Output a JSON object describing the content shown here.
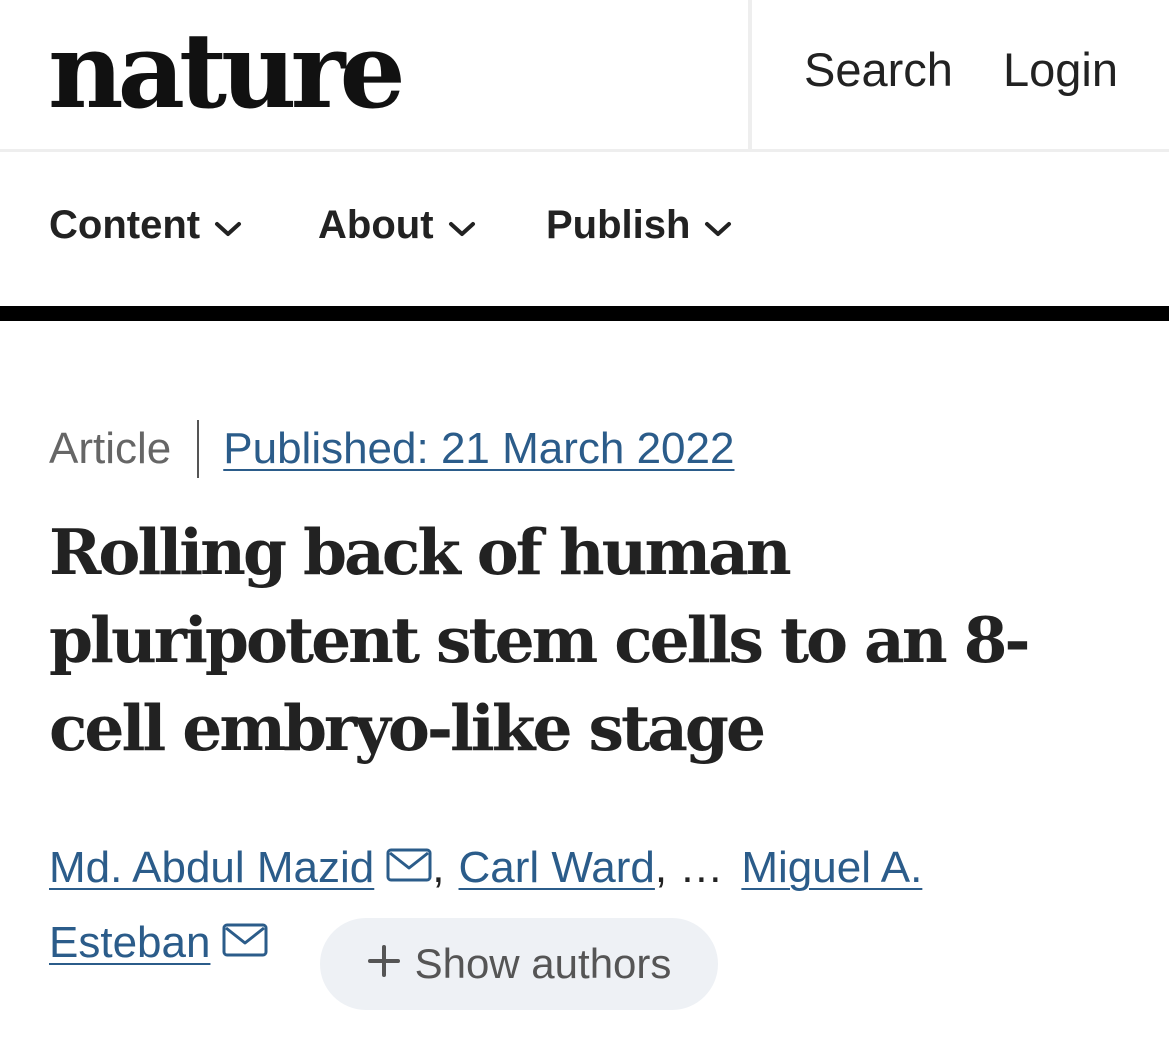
{
  "header": {
    "logo": "nature",
    "search_label": "Search",
    "login_label": "Login"
  },
  "nav": {
    "items": [
      {
        "label": "Content"
      },
      {
        "label": "About"
      },
      {
        "label": "Publish"
      }
    ]
  },
  "article": {
    "type": "Article",
    "published": "Published: 21 March 2022",
    "title": "Rolling back of human pluripotent stem cells to an 8-cell embryo-like stage",
    "authors": {
      "first": "Md. Abdul Mazid",
      "sep1": ",",
      "second": "Carl Ward",
      "ellipsis": ", …",
      "last_part1": "Miguel A.",
      "last_part2": "Esteban",
      "show_authors": "Show authors"
    }
  },
  "colors": {
    "link": "#2b5c8a",
    "text": "#222222",
    "muted": "#666666",
    "button_bg": "#eef1f5"
  },
  "icons": [
    "chevron-down-icon",
    "mail-icon",
    "plus-icon"
  ]
}
